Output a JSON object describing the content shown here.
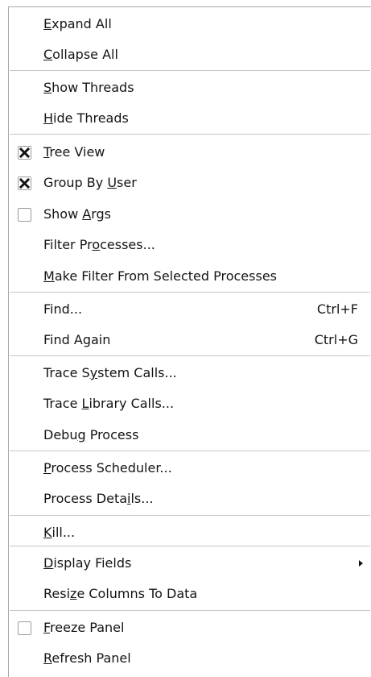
{
  "menu": {
    "items": [
      {
        "id": "expand-all",
        "label": "Expand All",
        "u": 0
      },
      {
        "id": "collapse-all",
        "label": "Collapse All",
        "u": 0
      },
      {
        "sep": true
      },
      {
        "id": "show-threads",
        "label": "Show Threads",
        "u": 0
      },
      {
        "id": "hide-threads",
        "label": "Hide Threads",
        "u": 0
      },
      {
        "sep": true
      },
      {
        "id": "tree-view",
        "label": "Tree View",
        "u": 0,
        "check": true,
        "checked": true
      },
      {
        "id": "group-by-user",
        "label": "Group By User",
        "u": 9,
        "check": true,
        "checked": true
      },
      {
        "id": "show-args",
        "label": "Show Args",
        "u": 5,
        "check": true,
        "checked": false
      },
      {
        "id": "filter-processes",
        "label": "Filter Processes...",
        "u": 9
      },
      {
        "id": "make-filter",
        "label": "Make Filter From Selected Processes",
        "u": 0
      },
      {
        "sep": true
      },
      {
        "id": "find",
        "label": "Find...",
        "u": -1,
        "shortcut": "Ctrl+F"
      },
      {
        "id": "find-again",
        "label": "Find Again",
        "u": -1,
        "shortcut": "Ctrl+G"
      },
      {
        "sep": true
      },
      {
        "id": "trace-system-calls",
        "label": "Trace System Calls...",
        "u": 7
      },
      {
        "id": "trace-library-calls",
        "label": "Trace Library Calls...",
        "u": 6
      },
      {
        "id": "debug-process",
        "label": "Debug Process",
        "u": 4
      },
      {
        "sep": true
      },
      {
        "id": "process-scheduler",
        "label": "Process Scheduler...",
        "u": 0
      },
      {
        "id": "process-details",
        "label": "Process Details...",
        "u": 12
      },
      {
        "sep": true
      },
      {
        "id": "kill",
        "label": "Kill...",
        "u": 0
      },
      {
        "sep": true
      },
      {
        "id": "display-fields",
        "label": "Display Fields",
        "u": 0,
        "submenu": true
      },
      {
        "id": "resize-columns",
        "label": "Resize Columns To Data",
        "u": 4
      },
      {
        "sep": true
      },
      {
        "id": "freeze-panel",
        "label": "Freeze Panel",
        "u": 0,
        "check": true,
        "checked": false
      },
      {
        "id": "refresh-panel",
        "label": "Refresh Panel",
        "u": 0
      }
    ]
  },
  "icons": {
    "check_mark": "x-check-icon",
    "submenu_arrow": "chevron-right-icon"
  },
  "colors": {
    "text": "#141414",
    "separator": "#c8c8c8",
    "border": "#a9a9a9"
  }
}
